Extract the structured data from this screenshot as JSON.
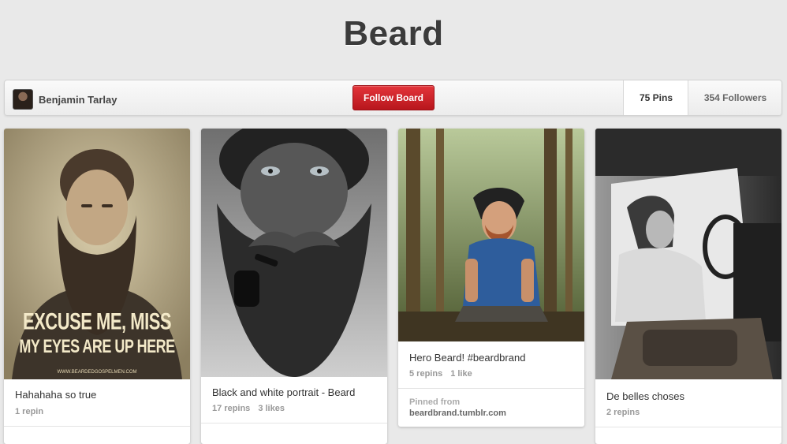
{
  "board": {
    "title": "Beard",
    "owner": "Benjamin Tarlay",
    "follow_label": "Follow Board",
    "pins_label": "75 Pins",
    "followers_label": "354 Followers"
  },
  "pins": [
    {
      "description": "Hahahaha so true",
      "stats": [
        "1 repin"
      ],
      "image_text_line1": "EXCUSE ME, MISS",
      "image_text_line2": "MY EYES ARE UP HERE",
      "image_credit": "WWW.BEARDEDGOSPELMEN.COM"
    },
    {
      "description": "Black and white portrait - Beard",
      "stats": [
        "17 repins",
        "3 likes"
      ]
    },
    {
      "description": "Hero Beard! #beardbrand",
      "stats": [
        "5 repins",
        "1 like"
      ],
      "source_label": "Pinned from",
      "source_domain": "beardbrand.tumblr.com"
    },
    {
      "description": "De belles choses",
      "stats": [
        "2 repins"
      ]
    }
  ],
  "colors": {
    "background": "#e9e9e9",
    "follow_button": "#cb2027"
  }
}
